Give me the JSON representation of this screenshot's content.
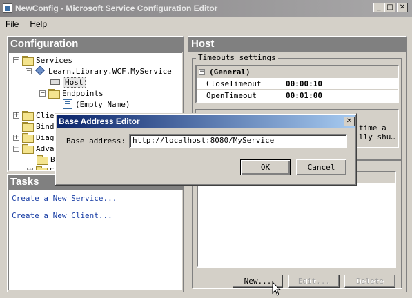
{
  "window": {
    "title": "NewConfig - Microsoft Service Configuration Editor"
  },
  "menu": {
    "file": "File",
    "help": "Help"
  },
  "configuration": {
    "header": "Configuration",
    "tree": {
      "services": "Services",
      "service": "Learn.Library.WCF.MyService",
      "host": "Host",
      "endpoints": "Endpoints",
      "empty_name": "(Empty Name)",
      "client": "Clie",
      "bindings": "Bind",
      "diagnostics": "Diag",
      "advanced": "Adva",
      "sub1": "B",
      "sub2": "S"
    }
  },
  "tasks": {
    "header": "Tasks",
    "create_service": "Create a New Service...",
    "create_client": "Create a New Client..."
  },
  "host": {
    "header": "Host",
    "timeouts_label": "Timeouts settings",
    "general_label": "(General)",
    "rows": [
      {
        "name": "CloseTimeout",
        "value": "00:00:10"
      },
      {
        "name": "OpenTimeout",
        "value": "00:01:00"
      }
    ],
    "desc_line1": "time a",
    "desc_line2": "lly shu…",
    "new_button": "New...",
    "edit_button": "Edit...",
    "delete_button": "Delete"
  },
  "dialog": {
    "title": "Base Address Editor",
    "label": "Base address:",
    "value": "http://localhost:8080/MyService",
    "ok": "OK",
    "cancel": "Cancel"
  }
}
